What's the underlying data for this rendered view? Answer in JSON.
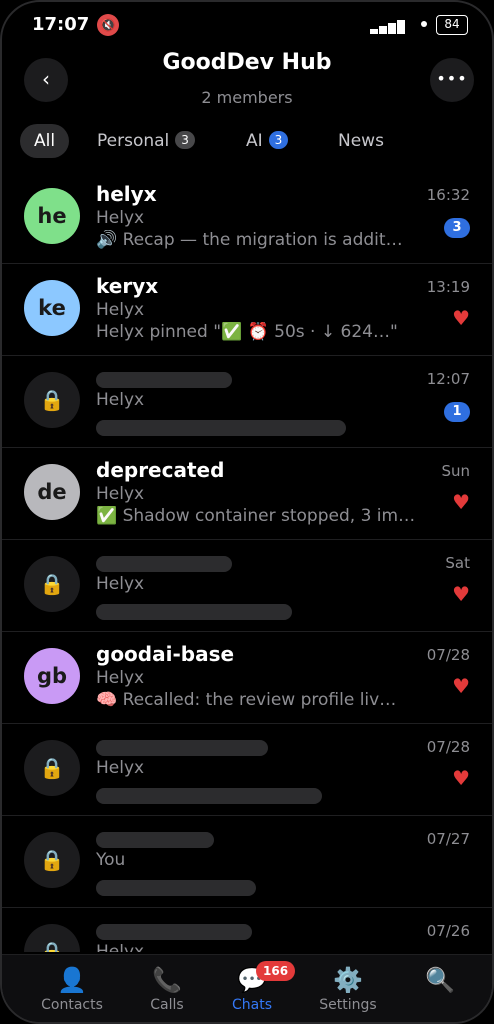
{
  "status_bar": {
    "time": "17:07",
    "battery": "84"
  },
  "header": {
    "title": "GoodDev Hub",
    "subtitle": "2 members"
  },
  "tabs": [
    {
      "label": "All",
      "active": true
    },
    {
      "label": "Personal",
      "badge": "3"
    },
    {
      "label": "AI",
      "badge": "3"
    },
    {
      "label": "News"
    }
  ],
  "chats": [
    {
      "avatar": "he",
      "avatar_color": "#7fe08a",
      "name": "helyx",
      "sender": "Helyx",
      "preview": "🔊 Recap — the migration is addit…",
      "time": "16:32",
      "unread": "3"
    },
    {
      "avatar": "ke",
      "avatar_color": "#8cc8ff",
      "name": "keryx",
      "sender": "Helyx",
      "preview": "Helyx pinned \"✅ ⏰ 50s · ↓ 624…\"",
      "time": "13:19",
      "heart": true
    },
    {
      "locked": true,
      "sender": "Helyx",
      "time": "12:07",
      "unread": "1"
    },
    {
      "avatar": "de",
      "avatar_color": "#b8b8bc",
      "name": "deprecated",
      "sender": "Helyx",
      "preview": "✅ Shadow container stopped, 3 im…",
      "time": "Sun",
      "heart": true
    },
    {
      "locked": true,
      "sender": "Helyx",
      "time": "Sat",
      "heart": true
    },
    {
      "avatar": "gb",
      "avatar_color": "#c99af5",
      "name": "goodai-base",
      "sender": "Helyx",
      "preview": "🧠 Recalled: the review profile liv…",
      "time": "07/28",
      "heart": true
    },
    {
      "locked": true,
      "sender": "Helyx",
      "time": "07/28",
      "heart": true
    },
    {
      "locked": true,
      "sender": "You",
      "time": "07/27"
    },
    {
      "locked": true,
      "sender": "Helyx",
      "time": "07/26"
    }
  ],
  "nav": [
    {
      "label": "Contacts",
      "icon": "👤"
    },
    {
      "label": "Calls",
      "icon": "📞"
    },
    {
      "label": "Chats",
      "icon": "💬",
      "badge": "166",
      "active": true
    },
    {
      "label": "Settings",
      "icon": "⚙️"
    },
    {
      "label": "",
      "icon": "🔍"
    }
  ],
  "colors": {
    "accent": "#3478f6",
    "unread": "#2f6fe0",
    "heart": "#e33a3a"
  }
}
